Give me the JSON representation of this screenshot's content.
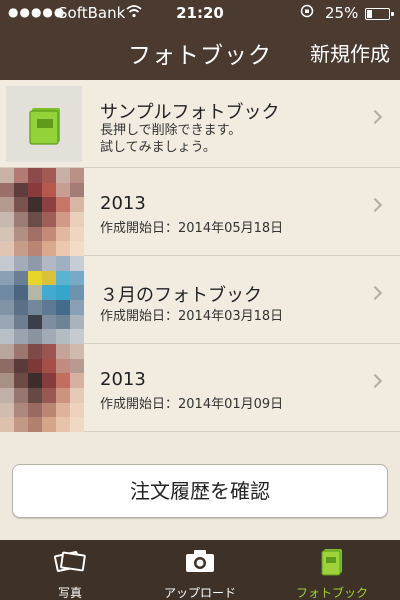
{
  "status_bar": {
    "signal": "●●●●●",
    "carrier": "SoftBank",
    "time": "21:20",
    "battery": "25%"
  },
  "nav": {
    "title": "フォトブック",
    "right_button": "新規作成"
  },
  "books": [
    {
      "title": "サンプルフォトブック",
      "desc_line1": "長押しで削除できます。",
      "desc_line2": "試してみましょう。",
      "icon": "green-book-icon"
    },
    {
      "title": "2013",
      "started": "作成開始日：2014年05月18日"
    },
    {
      "title": "３月のフォトブック",
      "started": "作成開始日：2014年03月18日"
    },
    {
      "title": "2013",
      "started": "作成開始日：2014年01月09日"
    }
  ],
  "order_history_button": "注文履歴を確認",
  "tabs": [
    {
      "label": "写真",
      "icon": "photos-icon"
    },
    {
      "label": "アップロード",
      "icon": "camera-icon"
    },
    {
      "label": "フォトブック",
      "icon": "photobook-icon",
      "active": true
    }
  ],
  "colors": {
    "header": "#4a3a2f",
    "background": "#efe9dd",
    "tabbar": "#3d3128",
    "accent_green": "#9ed23a"
  }
}
